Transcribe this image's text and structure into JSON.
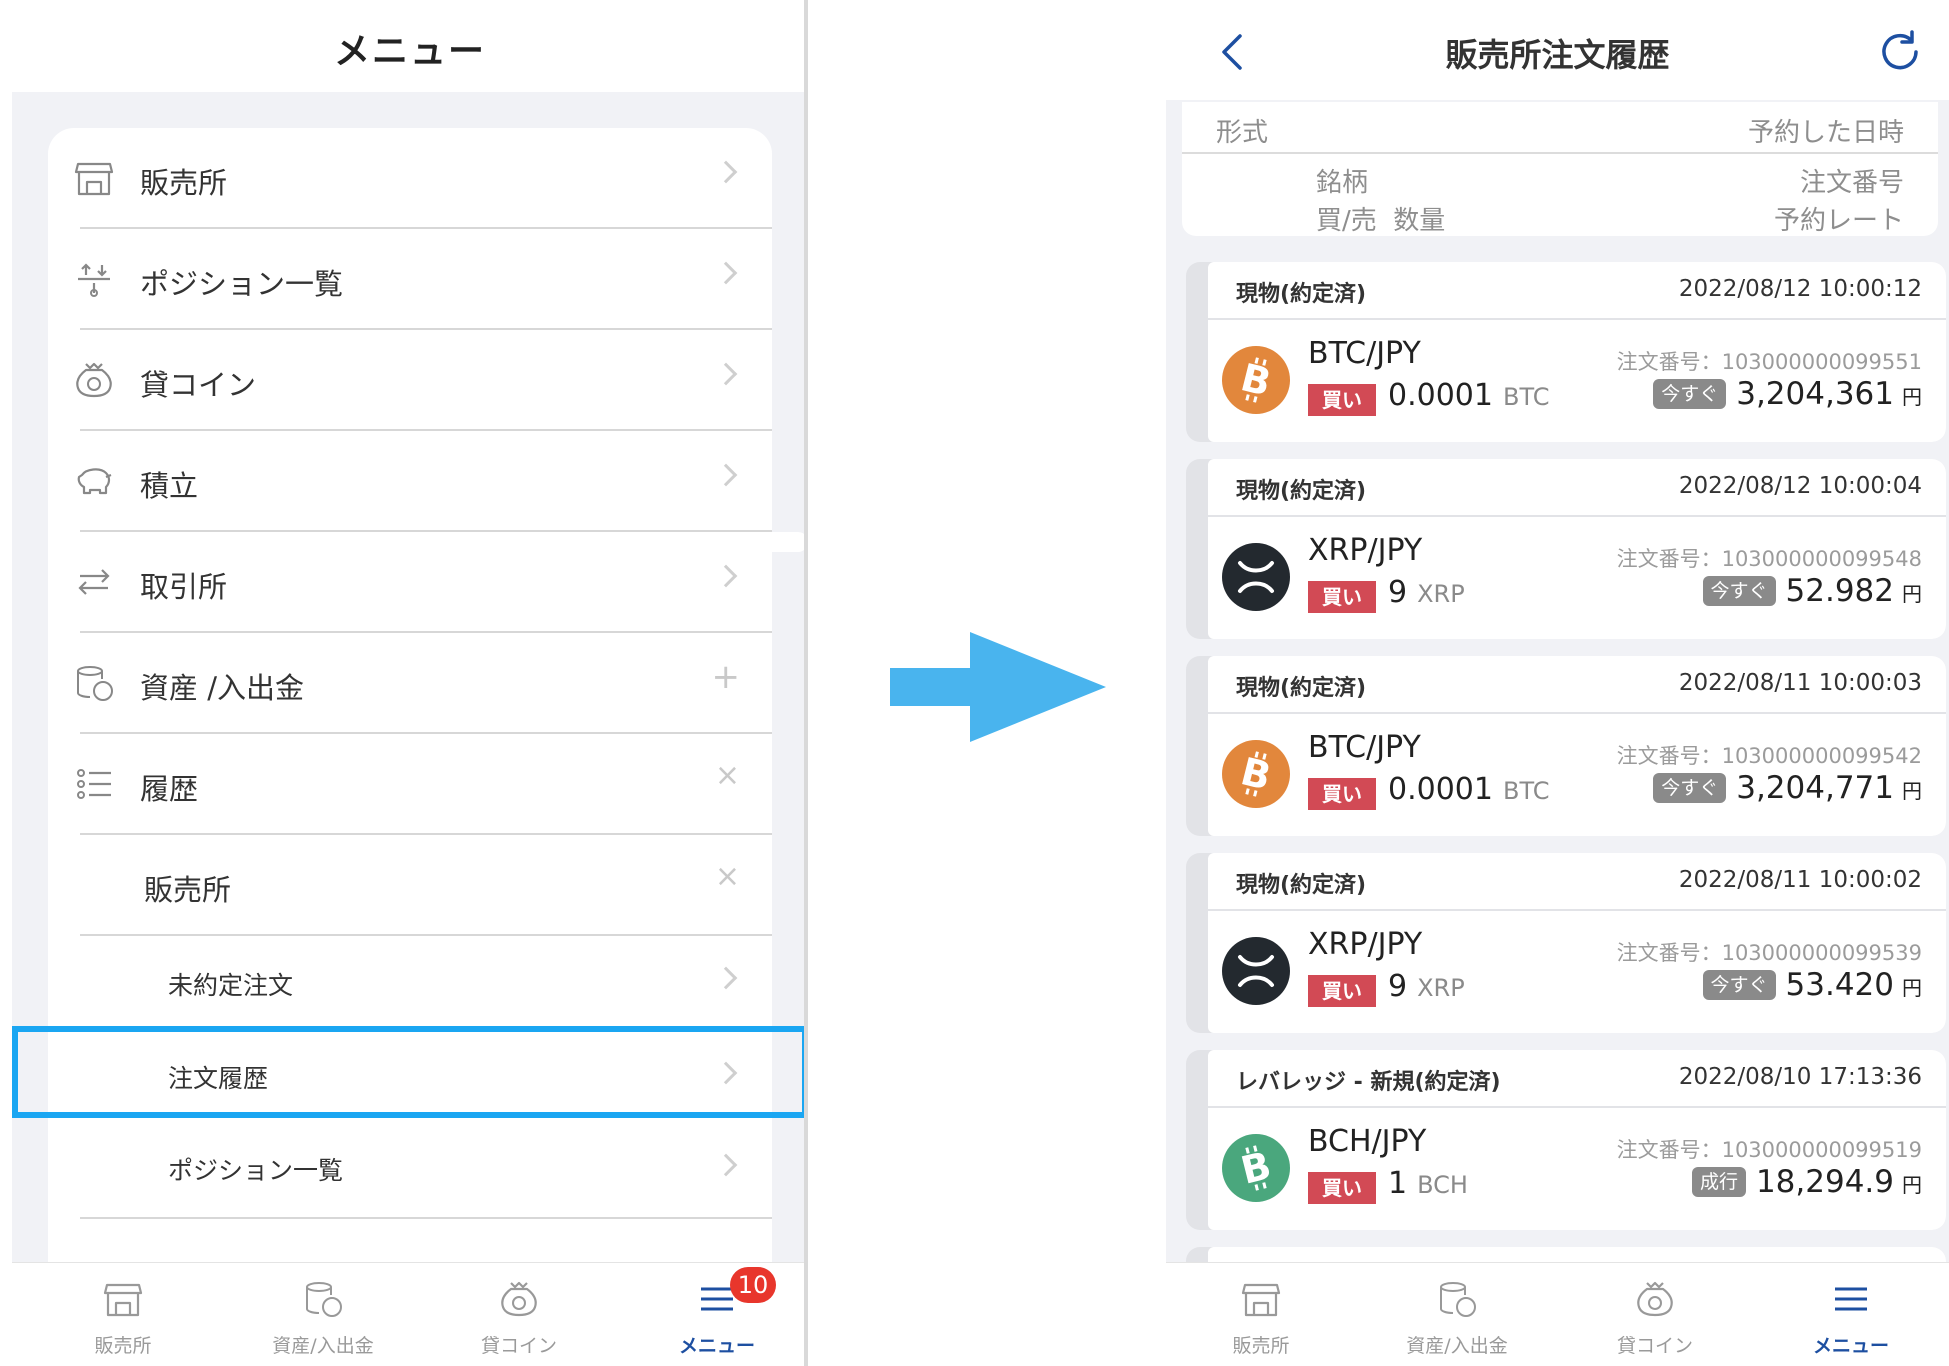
{
  "left": {
    "title": "メニュー",
    "items": [
      {
        "label": "販売所",
        "icon": "shop-icon",
        "action": "chevron"
      },
      {
        "label": "ポジション一覧",
        "icon": "position-icon",
        "action": "chevron"
      },
      {
        "label": "貸コイン",
        "icon": "coin-bag-icon",
        "action": "chevron"
      },
      {
        "label": "積立",
        "icon": "piggy-bank-icon",
        "action": "chevron"
      },
      {
        "label": "取引所",
        "icon": "exchange-icon",
        "action": "chevron"
      },
      {
        "label": "資産 /入出金",
        "icon": "coins-yen-icon",
        "action": "+"
      },
      {
        "label": "履歴",
        "icon": "list-icon",
        "action": "×"
      },
      {
        "label": "販売所",
        "action": "×"
      },
      {
        "label": "未約定注文",
        "action": "chevron"
      },
      {
        "label": "注文履歴",
        "action": "chevron"
      },
      {
        "label": "ポジション一覧",
        "action": "chevron"
      }
    ],
    "tabs": [
      {
        "label": "販売所"
      },
      {
        "label": "資産/入出金"
      },
      {
        "label": "貸コイン"
      },
      {
        "label": "メニュー",
        "badge": "10"
      }
    ]
  },
  "right": {
    "title": "販売所注文履歴",
    "legend": {
      "type": "形式",
      "reserved_at": "予約した日時",
      "symbol": "銘柄",
      "order_no": "注文番号",
      "side_qty": "買/売  数量",
      "rate": "予約レート"
    },
    "orders": [
      {
        "type": "現物(約定済)",
        "datetime": "2022/08/12 10:00:12",
        "pair": "BTC/JPY",
        "coin": "btc",
        "side": "買い",
        "qty": "0.0001",
        "unit": "BTC",
        "order_no": "注文番号：103000000099551",
        "order_type": "今すぐ",
        "rate": "3,204,361",
        "yen": "円"
      },
      {
        "type": "現物(約定済)",
        "datetime": "2022/08/12 10:00:04",
        "pair": "XRP/JPY",
        "coin": "xrp",
        "side": "買い",
        "qty": "9",
        "unit": "XRP",
        "order_no": "注文番号：103000000099548",
        "order_type": "今すぐ",
        "rate": "52.982",
        "yen": "円"
      },
      {
        "type": "現物(約定済)",
        "datetime": "2022/08/11 10:00:03",
        "pair": "BTC/JPY",
        "coin": "btc",
        "side": "買い",
        "qty": "0.0001",
        "unit": "BTC",
        "order_no": "注文番号：103000000099542",
        "order_type": "今すぐ",
        "rate": "3,204,771",
        "yen": "円"
      },
      {
        "type": "現物(約定済)",
        "datetime": "2022/08/11 10:00:02",
        "pair": "XRP/JPY",
        "coin": "xrp",
        "side": "買い",
        "qty": "9",
        "unit": "XRP",
        "order_no": "注文番号：103000000099539",
        "order_type": "今すぐ",
        "rate": "53.420",
        "yen": "円"
      },
      {
        "type": "レバレッジ - 新規(約定済)",
        "datetime": "2022/08/10 17:13:36",
        "pair": "BCH/JPY",
        "coin": "bch",
        "side": "買い",
        "qty": "1",
        "unit": "BCH",
        "order_no": "注文番号：103000000099519",
        "order_type": "成行",
        "rate": "18,294.9",
        "yen": "円"
      }
    ],
    "tabs": [
      {
        "label": "販売所"
      },
      {
        "label": "資産/入出金"
      },
      {
        "label": "貸コイン"
      },
      {
        "label": "メニュー"
      }
    ]
  },
  "colors": {
    "accent": "#1aa6f2",
    "active_tab": "#1d4fa1",
    "buy": "#d24a55",
    "btc": "#e2873c",
    "xrp": "#23292f",
    "bch": "#4aa77d",
    "badge": "#e8362c"
  }
}
